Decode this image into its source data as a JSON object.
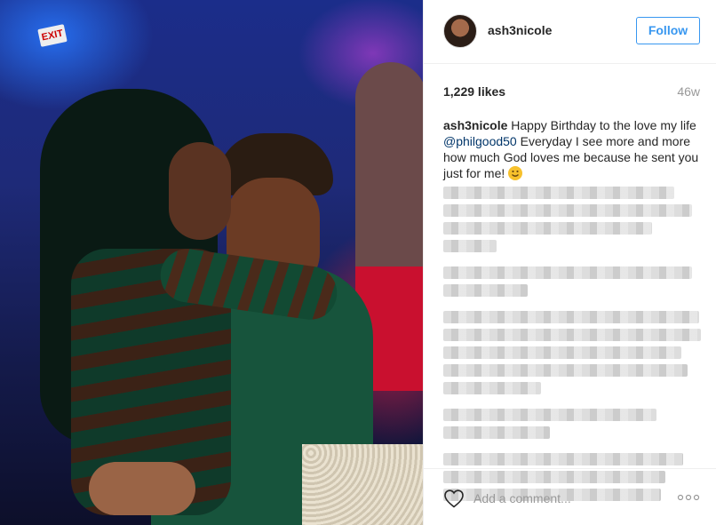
{
  "header": {
    "username": "ash3nicole",
    "follow_label": "Follow"
  },
  "post": {
    "likes": "1,229 likes",
    "time_ago": "46w",
    "caption": {
      "user": "ash3nicole",
      "text_before": " Happy Birthday to the love my life ",
      "mention": "@philgood50",
      "text_after": " Everyday I see more and more how much God loves me because he sent you just for me! "
    },
    "photo": {
      "exit_sign": "EXIT"
    }
  },
  "footer": {
    "comment_placeholder": "Add a comment..."
  },
  "colors": {
    "follow_blue": "#3897f0",
    "mention_blue": "#003569",
    "muted_gray": "#999999"
  },
  "icons": {
    "like": "heart-icon",
    "options": "more-icon",
    "emoji": "smile-emoji"
  }
}
